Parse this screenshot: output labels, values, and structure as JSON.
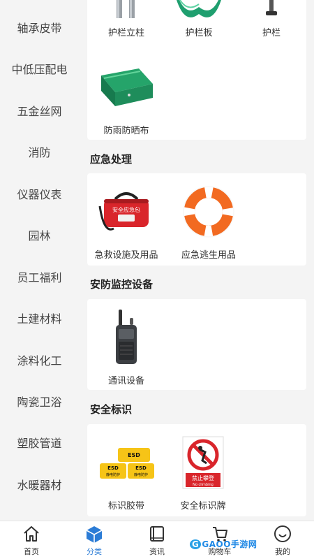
{
  "sidebar": {
    "items": [
      {
        "label": "轴承皮带"
      },
      {
        "label": "中低压配电"
      },
      {
        "label": "五金丝网"
      },
      {
        "label": "消防"
      },
      {
        "label": "仪器仪表"
      },
      {
        "label": "园林"
      },
      {
        "label": "员工福利"
      },
      {
        "label": "土建材料"
      },
      {
        "label": "涂料化工"
      },
      {
        "label": "陶瓷卫浴"
      },
      {
        "label": "塑胶管道"
      },
      {
        "label": "水暖器材"
      }
    ]
  },
  "sections": {
    "guardrail": {
      "items": [
        {
          "label": "护栏立柱",
          "icon": "guardrail-post-icon"
        },
        {
          "label": "护栏板",
          "icon": "guardrail-board-icon"
        },
        {
          "label": "护栏",
          "icon": "guardrail-icon"
        },
        {
          "label": "防雨防晒布",
          "icon": "tarp-icon"
        }
      ]
    },
    "emergency": {
      "title": "应急处理",
      "items": [
        {
          "label": "急救设施及用品",
          "icon": "first-aid-bag-icon",
          "bag_text": "安全应急包"
        },
        {
          "label": "应急逃生用品",
          "icon": "life-buoy-icon"
        }
      ]
    },
    "security": {
      "title": "安防监控设备",
      "items": [
        {
          "label": "通讯设备",
          "icon": "walkie-talkie-icon"
        }
      ]
    },
    "signs": {
      "title": "安全标识",
      "items": [
        {
          "label": "标识胶带",
          "icon": "esd-tape-icon",
          "tape_text": "ESD",
          "tape_sub": "静电防护"
        },
        {
          "label": "安全标识牌",
          "icon": "no-climbing-sign-icon",
          "sign_text": "禁止攀登",
          "sign_sub": "No climbing"
        }
      ]
    }
  },
  "bottom_nav": {
    "items": [
      {
        "label": "首页",
        "icon": "home-icon"
      },
      {
        "label": "分类",
        "icon": "category-cube-icon",
        "active": true
      },
      {
        "label": "资讯",
        "icon": "book-icon"
      },
      {
        "label": "购物车",
        "icon": "cart-icon"
      },
      {
        "label": "我的",
        "icon": "smile-face-icon"
      }
    ]
  },
  "watermark": {
    "text": "GAOO手游网",
    "g": "G"
  },
  "colors": {
    "accent": "#2b7cd6",
    "guardrail_green": "#1f9f6f",
    "bag_red": "#d9252b",
    "buoy_orange": "#f26a21",
    "tape_yellow": "#f6c417"
  }
}
